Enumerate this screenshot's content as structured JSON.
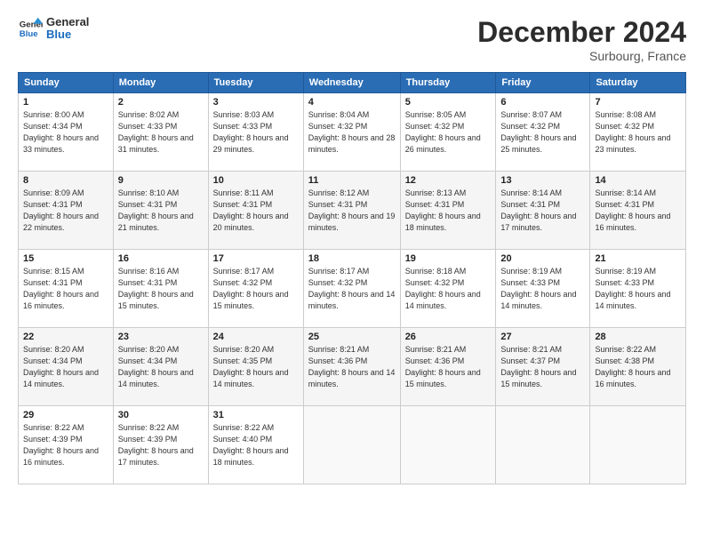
{
  "logo": {
    "line1": "General",
    "line2": "Blue"
  },
  "title": "December 2024",
  "location": "Surbourg, France",
  "header_days": [
    "Sunday",
    "Monday",
    "Tuesday",
    "Wednesday",
    "Thursday",
    "Friday",
    "Saturday"
  ],
  "weeks": [
    [
      {
        "day": "1",
        "sunrise": "8:00 AM",
        "sunset": "4:34 PM",
        "daylight": "8 hours and 33 minutes."
      },
      {
        "day": "2",
        "sunrise": "8:02 AM",
        "sunset": "4:33 PM",
        "daylight": "8 hours and 31 minutes."
      },
      {
        "day": "3",
        "sunrise": "8:03 AM",
        "sunset": "4:33 PM",
        "daylight": "8 hours and 29 minutes."
      },
      {
        "day": "4",
        "sunrise": "8:04 AM",
        "sunset": "4:32 PM",
        "daylight": "8 hours and 28 minutes."
      },
      {
        "day": "5",
        "sunrise": "8:05 AM",
        "sunset": "4:32 PM",
        "daylight": "8 hours and 26 minutes."
      },
      {
        "day": "6",
        "sunrise": "8:07 AM",
        "sunset": "4:32 PM",
        "daylight": "8 hours and 25 minutes."
      },
      {
        "day": "7",
        "sunrise": "8:08 AM",
        "sunset": "4:32 PM",
        "daylight": "8 hours and 23 minutes."
      }
    ],
    [
      {
        "day": "8",
        "sunrise": "8:09 AM",
        "sunset": "4:31 PM",
        "daylight": "8 hours and 22 minutes."
      },
      {
        "day": "9",
        "sunrise": "8:10 AM",
        "sunset": "4:31 PM",
        "daylight": "8 hours and 21 minutes."
      },
      {
        "day": "10",
        "sunrise": "8:11 AM",
        "sunset": "4:31 PM",
        "daylight": "8 hours and 20 minutes."
      },
      {
        "day": "11",
        "sunrise": "8:12 AM",
        "sunset": "4:31 PM",
        "daylight": "8 hours and 19 minutes."
      },
      {
        "day": "12",
        "sunrise": "8:13 AM",
        "sunset": "4:31 PM",
        "daylight": "8 hours and 18 minutes."
      },
      {
        "day": "13",
        "sunrise": "8:14 AM",
        "sunset": "4:31 PM",
        "daylight": "8 hours and 17 minutes."
      },
      {
        "day": "14",
        "sunrise": "8:14 AM",
        "sunset": "4:31 PM",
        "daylight": "8 hours and 16 minutes."
      }
    ],
    [
      {
        "day": "15",
        "sunrise": "8:15 AM",
        "sunset": "4:31 PM",
        "daylight": "8 hours and 16 minutes."
      },
      {
        "day": "16",
        "sunrise": "8:16 AM",
        "sunset": "4:31 PM",
        "daylight": "8 hours and 15 minutes."
      },
      {
        "day": "17",
        "sunrise": "8:17 AM",
        "sunset": "4:32 PM",
        "daylight": "8 hours and 15 minutes."
      },
      {
        "day": "18",
        "sunrise": "8:17 AM",
        "sunset": "4:32 PM",
        "daylight": "8 hours and 14 minutes."
      },
      {
        "day": "19",
        "sunrise": "8:18 AM",
        "sunset": "4:32 PM",
        "daylight": "8 hours and 14 minutes."
      },
      {
        "day": "20",
        "sunrise": "8:19 AM",
        "sunset": "4:33 PM",
        "daylight": "8 hours and 14 minutes."
      },
      {
        "day": "21",
        "sunrise": "8:19 AM",
        "sunset": "4:33 PM",
        "daylight": "8 hours and 14 minutes."
      }
    ],
    [
      {
        "day": "22",
        "sunrise": "8:20 AM",
        "sunset": "4:34 PM",
        "daylight": "8 hours and 14 minutes."
      },
      {
        "day": "23",
        "sunrise": "8:20 AM",
        "sunset": "4:34 PM",
        "daylight": "8 hours and 14 minutes."
      },
      {
        "day": "24",
        "sunrise": "8:20 AM",
        "sunset": "4:35 PM",
        "daylight": "8 hours and 14 minutes."
      },
      {
        "day": "25",
        "sunrise": "8:21 AM",
        "sunset": "4:36 PM",
        "daylight": "8 hours and 14 minutes."
      },
      {
        "day": "26",
        "sunrise": "8:21 AM",
        "sunset": "4:36 PM",
        "daylight": "8 hours and 15 minutes."
      },
      {
        "day": "27",
        "sunrise": "8:21 AM",
        "sunset": "4:37 PM",
        "daylight": "8 hours and 15 minutes."
      },
      {
        "day": "28",
        "sunrise": "8:22 AM",
        "sunset": "4:38 PM",
        "daylight": "8 hours and 16 minutes."
      }
    ],
    [
      {
        "day": "29",
        "sunrise": "8:22 AM",
        "sunset": "4:39 PM",
        "daylight": "8 hours and 16 minutes."
      },
      {
        "day": "30",
        "sunrise": "8:22 AM",
        "sunset": "4:39 PM",
        "daylight": "8 hours and 17 minutes."
      },
      {
        "day": "31",
        "sunrise": "8:22 AM",
        "sunset": "4:40 PM",
        "daylight": "8 hours and 18 minutes."
      },
      null,
      null,
      null,
      null
    ]
  ],
  "labels": {
    "sunrise": "Sunrise:",
    "sunset": "Sunset:",
    "daylight": "Daylight:"
  }
}
